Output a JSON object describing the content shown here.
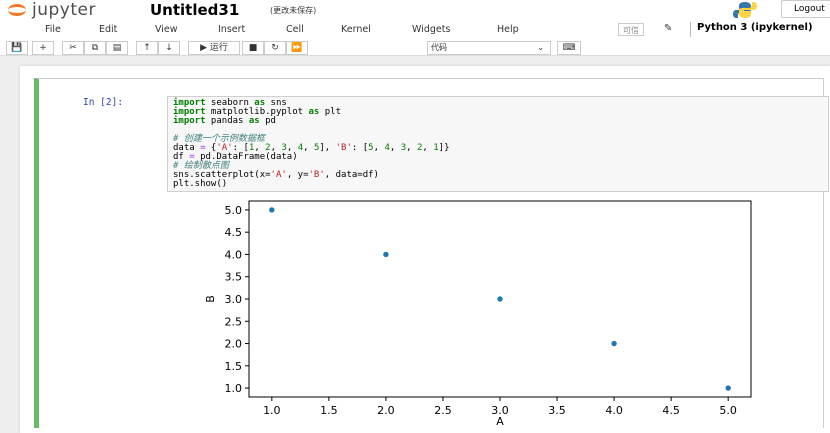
{
  "header": {
    "logo_text": "jupyter",
    "notebook_name": "Untitled31",
    "save_status": "(更改未保存)",
    "logout_label": "Logout"
  },
  "menubar": {
    "items": [
      "File",
      "Edit",
      "View",
      "Insert",
      "Cell",
      "Kernel",
      "Widgets",
      "Help"
    ],
    "trusted_label": "可信",
    "kernel_name": "Python 3 (ipykernel)"
  },
  "toolbar": {
    "run_label": "运行",
    "cell_type": "代码"
  },
  "cell": {
    "prompt": "In  [2]:",
    "code_lines": [
      "import seaborn as sns",
      "import matplotlib.pyplot as plt",
      "import pandas as pd",
      "",
      "# 创建一个示例数据框",
      "data = {'A': [1, 2, 3, 4, 5], 'B': [5, 4, 3, 2, 1]}",
      "df = pd.DataFrame(data)",
      "# 绘制散点图",
      "sns.scatterplot(x='A', y='B', data=df)",
      "plt.show()"
    ]
  },
  "chart_data": {
    "type": "scatter",
    "x": [
      1,
      2,
      3,
      4,
      5
    ],
    "y": [
      5,
      4,
      3,
      2,
      1
    ],
    "xlabel": "A",
    "ylabel": "B",
    "xlim": [
      0.8,
      5.2
    ],
    "ylim": [
      0.8,
      5.2
    ],
    "xticks": [
      "1.0",
      "1.5",
      "2.0",
      "2.5",
      "3.0",
      "3.5",
      "4.0",
      "4.5",
      "5.0"
    ],
    "yticks": [
      "1.0",
      "1.5",
      "2.0",
      "2.5",
      "3.0",
      "3.5",
      "4.0",
      "4.5",
      "5.0"
    ],
    "grid": false,
    "point_color": "#1f77b4"
  },
  "colors": {
    "cell_border_active": "#66bb6a",
    "prompt": "#303f9f",
    "logo_orange": "#f37726"
  }
}
